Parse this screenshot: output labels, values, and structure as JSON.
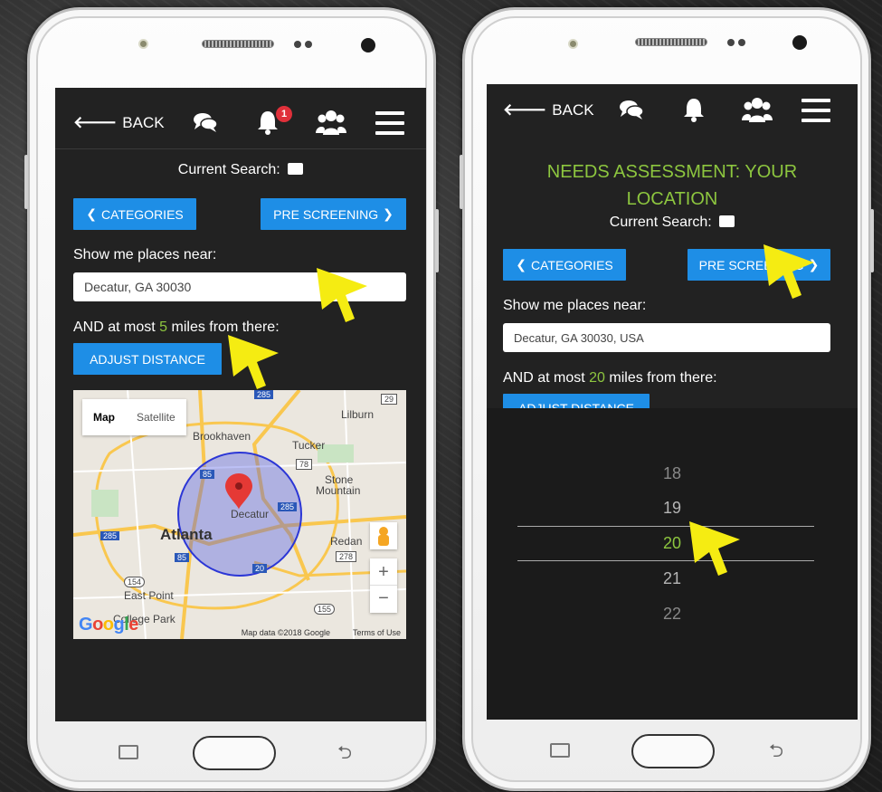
{
  "left_screen": {
    "header": {
      "back_label": "BACK",
      "notification_count": "1"
    },
    "current_search_label": "Current Search:",
    "categories_button": "CATEGORIES",
    "prescreening_button": "PRE SCREENING",
    "near_label": "Show me places near:",
    "location_value": "Decatur, GA 30030",
    "distance_prefix": "AND at most",
    "distance_value": "5",
    "distance_suffix": "miles from there:",
    "adjust_button": "ADJUST DISTANCE",
    "map": {
      "toggle_map": "Map",
      "toggle_satellite": "Satellite",
      "labels": [
        "Lilburn",
        "Brookhaven",
        "Tucker",
        "Stone",
        "Mountain",
        "Decatur",
        "Atlanta",
        "Redan",
        "East Point",
        "College Park"
      ],
      "road_shields": [
        "285",
        "29",
        "78",
        "85",
        "285",
        "285",
        "278",
        "85",
        "20",
        "154",
        "155"
      ],
      "attribution": "Map data ©2018 Google",
      "terms": "Terms of Use",
      "logo": "Google"
    }
  },
  "right_screen": {
    "header": {
      "back_label": "BACK"
    },
    "page_title": "NEEDS ASSESSMENT: YOUR LOCATION",
    "title_line1": "NEEDS ASSESSMENT: YOUR",
    "title_line2": "LOCATION",
    "current_search_label": "Current Search:",
    "categories_button": "CATEGORIES",
    "prescreening_button": "PRE SCREENING",
    "near_label": "Show me places near:",
    "location_value": "Decatur, GA 30030, USA",
    "distance_prefix": "AND at most",
    "distance_value": "20",
    "distance_suffix": "miles from there:",
    "adjust_button": "ADJUST DISTANCE",
    "picker": {
      "options": [
        "18",
        "19",
        "20",
        "21",
        "22"
      ],
      "selected": "20"
    }
  },
  "colors": {
    "accent_blue": "#1e8ee6",
    "accent_green": "#8dc63f",
    "badge_red": "#e0303a",
    "pointer_yellow": "#f5ec12"
  }
}
